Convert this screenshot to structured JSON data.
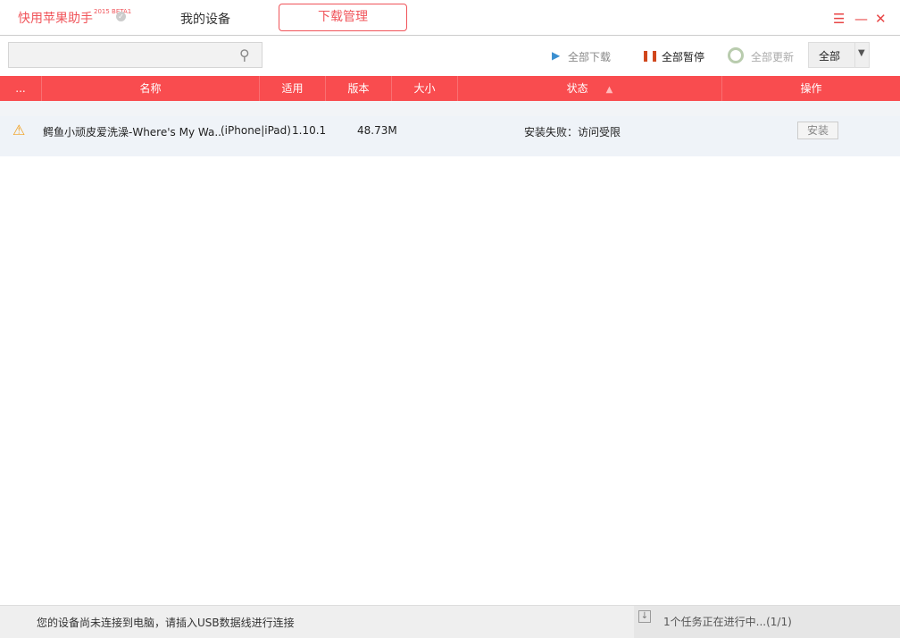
{
  "header": {
    "logo": "快用苹果助手",
    "logo_badge": "2015 BETA1",
    "tabs": [
      {
        "label": "我的设备"
      },
      {
        "label": "下载管理",
        "active": true
      }
    ]
  },
  "toolbar": {
    "search_placeholder": "",
    "download_all": "全部下载",
    "pause_all": "全部暂停",
    "update_all": "全部更新",
    "filter": "全部"
  },
  "table": {
    "columns": [
      "...",
      "名称",
      "适用",
      "版本",
      "大小",
      "状态",
      "操作"
    ],
    "rows": [
      {
        "name": "鳄鱼小顽皮爱洗澡-Where's My Wa...",
        "device": "(iPhone|iPad)",
        "version": "1.10.1",
        "size": "48.73M",
        "status": "安装失败：访问受限",
        "action": "安装"
      }
    ]
  },
  "statusbar": {
    "message": "您的设备尚未连接到电脑，请插入USB数据线进行连接",
    "tasks": "1个任务正在进行中...(1/1)"
  },
  "colors": {
    "accent": "#f94c4f"
  }
}
